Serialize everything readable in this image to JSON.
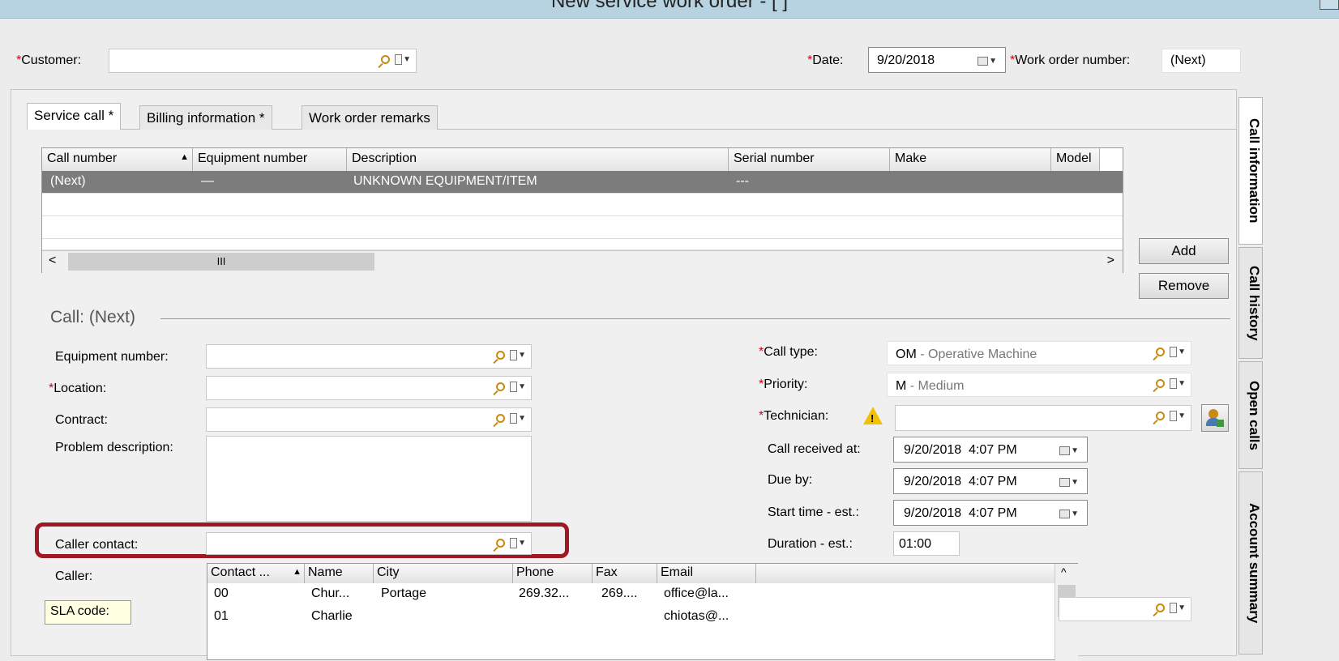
{
  "window": {
    "title": "New service work order - [ ]"
  },
  "header": {
    "customer_label": "Customer:",
    "customer_value": "",
    "date_label": "Date:",
    "date_value": "9/20/2018",
    "work_order_label": "Work order number:",
    "work_order_value": "(Next)"
  },
  "tabs": [
    {
      "label": "Service call *"
    },
    {
      "label": "Billing information *"
    },
    {
      "label": "Work order remarks"
    }
  ],
  "side_tabs": [
    {
      "label": "Call information"
    },
    {
      "label": "Call history"
    },
    {
      "label": "Open calls"
    },
    {
      "label": "Account summary"
    }
  ],
  "equipment_grid": {
    "columns": [
      "Call number",
      "Equipment number",
      "Description",
      "Serial number",
      "Make",
      "Model"
    ],
    "rows": [
      {
        "call_number": "(Next)",
        "equipment_number": "—",
        "description": "UNKNOWN EQUIPMENT/ITEM",
        "serial_number": "---",
        "make": "",
        "model": ""
      }
    ],
    "scroll_thumb_label": "III"
  },
  "buttons": {
    "add": "Add",
    "remove": "Remove"
  },
  "call_section": {
    "heading": "Call: (Next)",
    "equipment_number_label": "Equipment number:",
    "location_label": "Location:",
    "contract_label": "Contract:",
    "problem_description_label": "Problem description:",
    "caller_contact_label": "Caller contact:",
    "caller_label": "Caller:",
    "sla_code_label": "SLA code:",
    "call_type_label": "Call type:",
    "call_type_code": "OM",
    "call_type_desc": " - Operative Machine",
    "priority_label": "Priority:",
    "priority_code": "M",
    "priority_desc": " - Medium",
    "technician_label": "Technician:",
    "call_received_label": "Call received at:",
    "call_received_value": "9/20/2018  4:07 PM",
    "due_by_label": "Due by:",
    "due_by_value": "9/20/2018  4:07 PM",
    "start_time_label": "Start time - est.:",
    "start_time_value": "9/20/2018  4:07 PM",
    "duration_label": "Duration - est.:",
    "duration_value": "01:00"
  },
  "contact_list": {
    "columns": [
      "Contact ...",
      "Name",
      "City",
      "Phone",
      "Fax",
      "Email"
    ],
    "rows": [
      {
        "contact": "00",
        "name": "Chur...",
        "city": "Portage",
        "phone": "269.32...",
        "fax": "269....",
        "email": "office@la..."
      },
      {
        "contact": "01",
        "name": "Charlie",
        "city": "",
        "phone": "",
        "fax": "",
        "email": "chiotas@..."
      }
    ]
  },
  "colors": {
    "required": "#d0021b",
    "highlight": "#a01824",
    "selected_row": "#7c7c7c",
    "titlebar": "#b7d2e0"
  }
}
